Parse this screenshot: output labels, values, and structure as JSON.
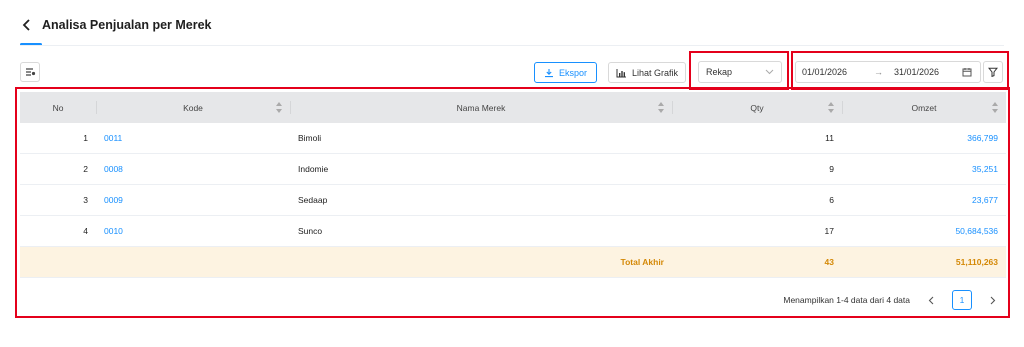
{
  "header": {
    "title": "Analisa Penjualan per Merek"
  },
  "toolbar": {
    "export_label": "Ekspor",
    "chart_label": "Lihat Grafik",
    "view_select_value": "Rekap",
    "date_from": "01/01/2026",
    "date_arrow": "→",
    "date_to": "31/01/2026"
  },
  "table": {
    "columns": [
      "No",
      "Kode",
      "Nama Merek",
      "Qty",
      "Omzet"
    ],
    "rows": [
      {
        "no": "1",
        "kode": "0011",
        "nama": "Bimoli",
        "qty": "11",
        "omzet": "366,799"
      },
      {
        "no": "2",
        "kode": "0008",
        "nama": "Indomie",
        "qty": "9",
        "omzet": "35,251"
      },
      {
        "no": "3",
        "kode": "0009",
        "nama": "Sedaap",
        "qty": "6",
        "omzet": "23,677"
      },
      {
        "no": "4",
        "kode": "0010",
        "nama": "Sunco",
        "qty": "17",
        "omzet": "50,684,536"
      }
    ],
    "total": {
      "label": "Total Akhir",
      "qty": "43",
      "omzet": "51,110,263"
    }
  },
  "pagination": {
    "summary": "Menampilkan 1-4 data dari 4 data",
    "current_page": "1"
  },
  "colors": {
    "accent": "#1890ff",
    "highlight_border": "#e4001b",
    "total_text": "#d48806",
    "total_bg": "#fdf3e1",
    "header_bg": "#e6e7e9"
  }
}
